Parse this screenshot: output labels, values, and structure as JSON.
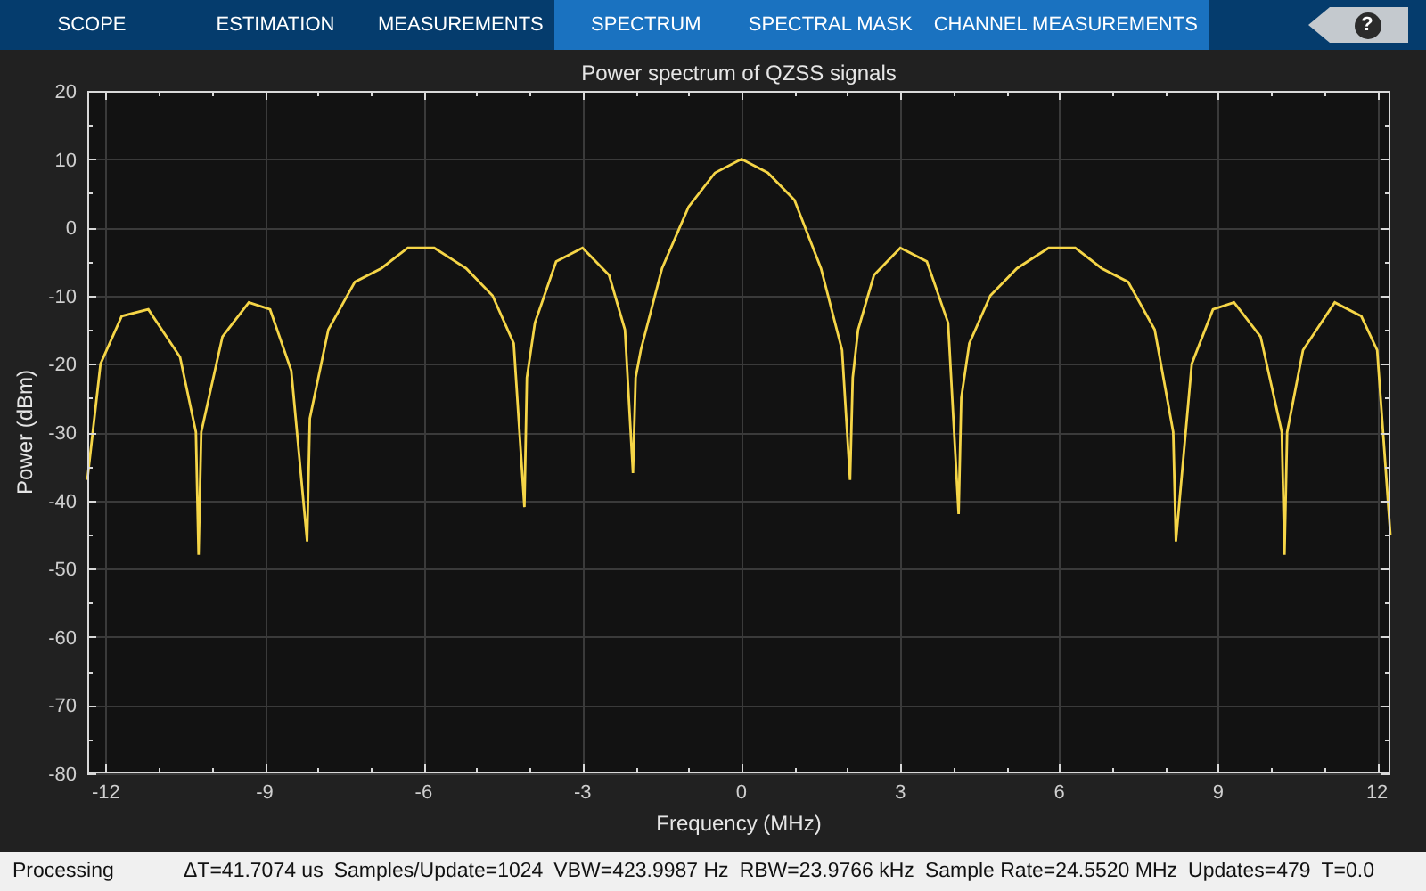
{
  "toolstrip": {
    "tabs": [
      {
        "label": "SCOPE",
        "contextual": false
      },
      {
        "label": "ESTIMATION",
        "contextual": false
      },
      {
        "label": "MEASUREMENTS",
        "contextual": false
      },
      {
        "label": "SPECTRUM",
        "contextual": true
      },
      {
        "label": "SPECTRAL MASK",
        "contextual": true
      },
      {
        "label": "CHANNEL MEASUREMENTS",
        "contextual": true
      }
    ],
    "help": "?"
  },
  "plot": {
    "chart_data": {
      "type": "line",
      "title": "Power spectrum of QZSS signals",
      "xlabel": "Frequency (MHz)",
      "ylabel": "Power (dBm)",
      "grid": true,
      "xlim": [
        -12.35,
        12.25
      ],
      "ylim": [
        -80,
        20
      ],
      "xticks": [
        -12,
        -9,
        -6,
        -3,
        0,
        3,
        6,
        9,
        12
      ],
      "yticks": [
        -80,
        -70,
        -60,
        -50,
        -40,
        -30,
        -20,
        -10,
        0,
        10,
        20
      ],
      "x": [
        -12.35,
        -12.1,
        -11.7,
        -11.2,
        -10.6,
        -10.3,
        -10.25,
        -10.2,
        -9.8,
        -9.3,
        -8.9,
        -8.5,
        -8.2,
        -8.15,
        -7.8,
        -7.3,
        -6.8,
        -6.3,
        -5.8,
        -5.2,
        -4.7,
        -4.3,
        -4.1,
        -4.05,
        -3.9,
        -3.5,
        -3.0,
        -2.5,
        -2.2,
        -2.05,
        -2.0,
        -1.9,
        -1.5,
        -1.0,
        -0.5,
        0,
        0.5,
        1.0,
        1.5,
        1.9,
        2.05,
        2.1,
        2.2,
        2.5,
        3.0,
        3.5,
        3.9,
        4.1,
        4.15,
        4.3,
        4.7,
        5.2,
        5.8,
        6.3,
        6.8,
        7.3,
        7.8,
        8.15,
        8.2,
        8.5,
        8.9,
        9.3,
        9.8,
        10.2,
        10.25,
        10.3,
        10.6,
        11.2,
        11.7,
        12.0,
        12.25
      ],
      "series": [
        {
          "color": "#f5d547",
          "values": [
            -37,
            -20,
            -13,
            -12,
            -19,
            -30,
            -48,
            -30,
            -16,
            -11,
            -12,
            -21,
            -46,
            -28,
            -15,
            -8,
            -6,
            -3,
            -3,
            -6,
            -10,
            -17,
            -41,
            -22,
            -14,
            -5,
            -3,
            -7,
            -15,
            -36,
            -22,
            -18,
            -6,
            3,
            8,
            10,
            8,
            4,
            -6,
            -18,
            -37,
            -22,
            -15,
            -7,
            -3,
            -5,
            -14,
            -42,
            -25,
            -17,
            -10,
            -6,
            -3,
            -3,
            -6,
            -8,
            -15,
            -30,
            -46,
            -20,
            -12,
            -11,
            -16,
            -30,
            -48,
            -30,
            -18,
            -11,
            -13,
            -18,
            -45
          ]
        }
      ]
    }
  },
  "status_bar": {
    "state": "Processing",
    "items": [
      "ΔT=41.7074 us",
      "Samples/Update=1024",
      "VBW=423.9987 Hz",
      "RBW=23.9766 kHz",
      "Sample Rate=24.5520 MHz",
      "Updates=479",
      "T=0.0"
    ]
  }
}
